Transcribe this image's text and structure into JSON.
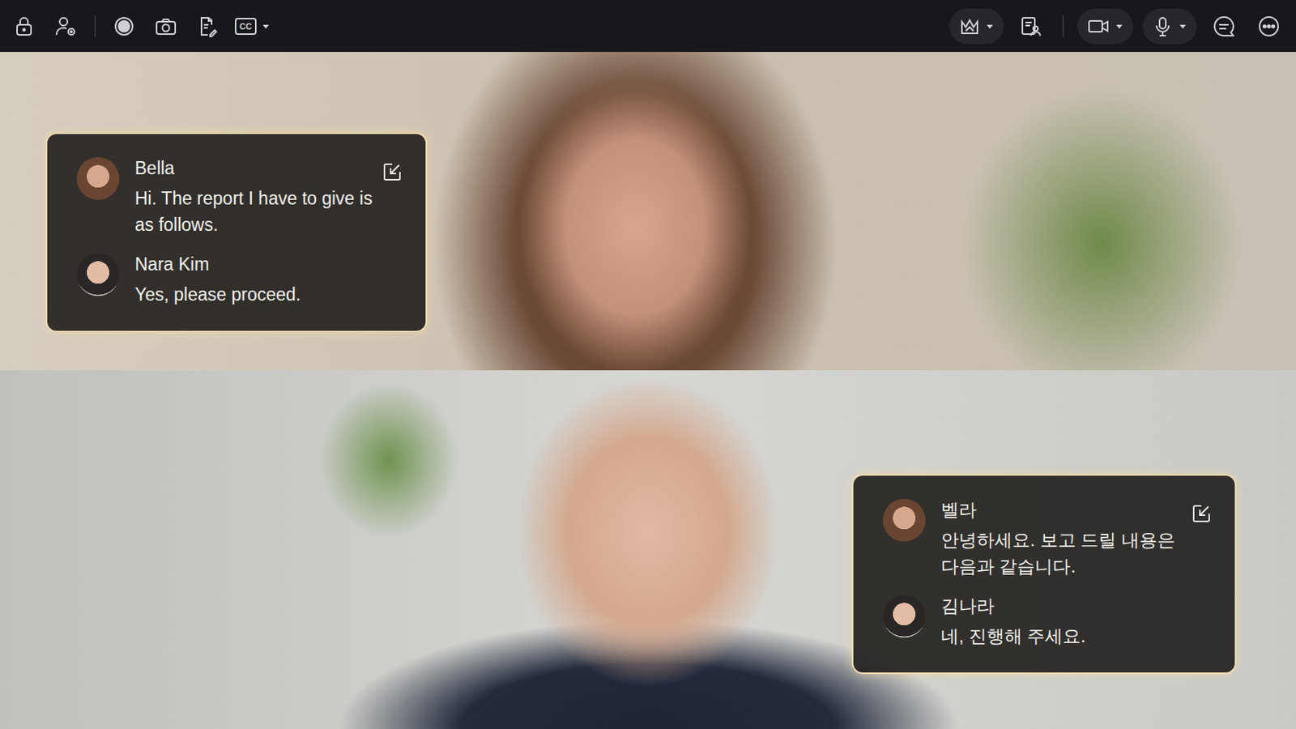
{
  "toolbar": {
    "cc_label": "CC"
  },
  "videos": [
    {
      "captions": [
        {
          "speaker": "Bella",
          "text": "Hi. The report I have to give is as follows."
        },
        {
          "speaker": "Nara Kim",
          "text": "Yes, please proceed."
        }
      ]
    },
    {
      "captions": [
        {
          "speaker": "벨라",
          "text": "안녕하세요. 보고 드릴 내용은 다음과 같습니다."
        },
        {
          "speaker": "김나라",
          "text": "네, 진행해 주세요."
        }
      ]
    }
  ]
}
